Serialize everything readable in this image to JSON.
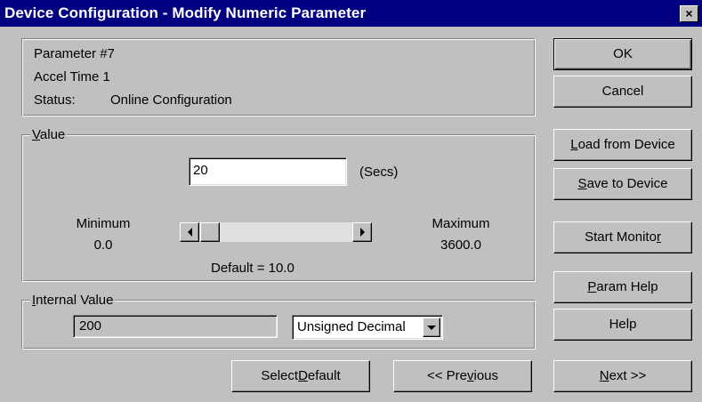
{
  "window": {
    "title": "Device Configuration - Modify Numeric Parameter",
    "close_glyph": "×"
  },
  "info": {
    "parameter": "Parameter #7",
    "name": "Accel Time 1",
    "status_label": "Status:",
    "status_value": "Online Configuration"
  },
  "value_group": {
    "legend_first": "V",
    "legend_rest": "alue",
    "input_value": "20",
    "units": "(Secs)",
    "minimum_label": "Minimum",
    "minimum_value": "0.0",
    "maximum_label": "Maximum",
    "maximum_value": "3600.0",
    "default_text": "Default = 10.0",
    "slider_fraction": 0.0056
  },
  "internal_group": {
    "legend_first": "I",
    "legend_rest": "nternal Value",
    "value": "200",
    "format_selected": "Unsigned Decimal"
  },
  "buttons": {
    "ok": "OK",
    "cancel": "Cancel",
    "load_first": "L",
    "load_rest": "oad from Device",
    "save_first": "S",
    "save_rest": "ave to Device",
    "monitor_pre": "Start Monito",
    "monitor_u": "r",
    "param_help_first": "P",
    "param_help_rest": "aram Help",
    "help": "Help",
    "select_default_pre": "Select ",
    "select_default_u": "D",
    "select_default_rest": "efault",
    "previous_pre": "<< Pre",
    "previous_u": "v",
    "previous_rest": "ious",
    "next_u": "N",
    "next_rest": "ext >>"
  },
  "colors": {
    "titlebar": "#000080",
    "face": "#c0c0c0"
  }
}
